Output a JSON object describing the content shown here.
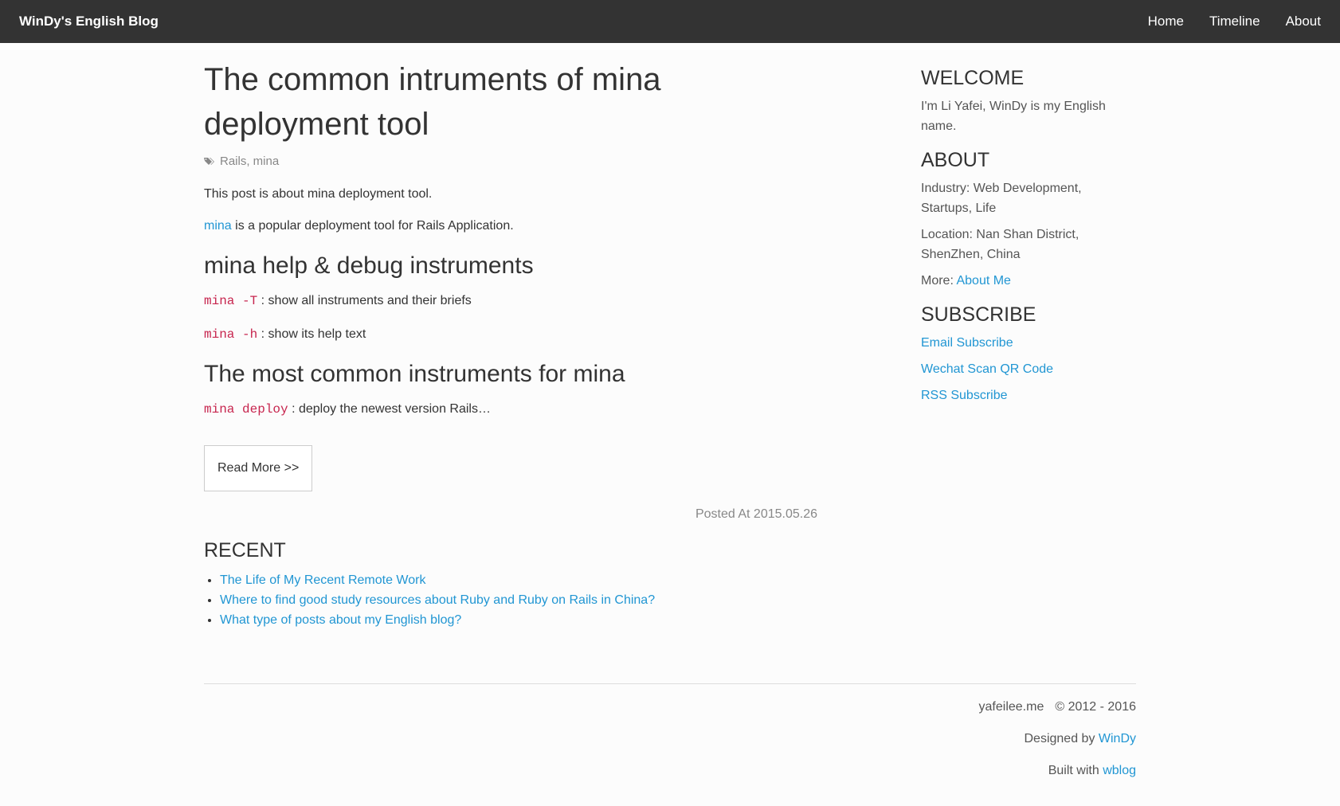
{
  "navbar": {
    "brand": "WinDy's English Blog",
    "links": [
      "Home",
      "Timeline",
      "About"
    ]
  },
  "post": {
    "title": "The common intruments of mina deployment tool",
    "tags": "Rails, mina",
    "tag_icon": "tags-icon",
    "intro": "This post is about mina deployment tool.",
    "mina_link": "mina",
    "mina_desc": " is a popular deployment tool for Rails Application.",
    "h_debug": "mina help & debug instruments",
    "cmd1": "mina -T",
    "cmd1_desc": " : show all instruments and their briefs",
    "cmd2": "mina -h",
    "cmd2_desc": " : show its help text",
    "h_common": "The most common instruments for mina",
    "cmd3": "mina deploy",
    "cmd3_desc": " : deploy the newest version Rails…",
    "read_more": "Read More >>",
    "posted": "Posted At 2015.05.26"
  },
  "recent": {
    "title": "RECENT",
    "items": [
      "The Life of My Recent Remote Work",
      "Where to find good study resources about Ruby and Ruby on Rails in China?",
      "What type of posts about my English blog?"
    ]
  },
  "sidebar": {
    "welcome_title": "WELCOME",
    "welcome_text": "I'm Li Yafei, WinDy is my English name.",
    "about_title": "ABOUT",
    "industry": "Industry:  Web Development, Startups, Life",
    "location": "Location:  Nan Shan District, ShenZhen, China",
    "more_label": "More: ",
    "more_link": "About Me",
    "subscribe_title": "SUBSCRIBE",
    "subscribe_links": [
      "Email Subscribe",
      "Wechat Scan QR Code",
      "RSS Subscribe"
    ]
  },
  "footer": {
    "site": "yafeilee.me",
    "copyright": "© 2012 - 2016",
    "designed_label": "Designed by ",
    "designed_link": "WinDy",
    "built_label": "Built with ",
    "built_link": "wblog"
  },
  "colors": {
    "navbar_bg": "#333333",
    "link": "#2196d3",
    "code": "#c7254e"
  }
}
